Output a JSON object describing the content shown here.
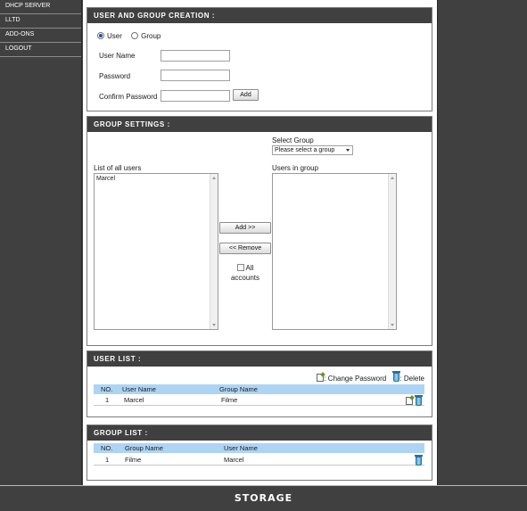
{
  "sidebar": {
    "items": [
      {
        "label": "DHCP SERVER"
      },
      {
        "label": "LLTD"
      },
      {
        "label": "ADD-ONS"
      },
      {
        "label": "LOGOUT"
      }
    ]
  },
  "creation": {
    "title": "USER AND GROUP CREATION :",
    "radio_user": "User",
    "radio_group": "Group",
    "selected": "User",
    "username_label": "User Name",
    "password_label": "Password",
    "confirm_label": "Confirm Password",
    "add_button": "Add"
  },
  "group_settings": {
    "title": "GROUP SETTINGS :",
    "select_group_label": "Select Group",
    "select_group_value": "Please select a group",
    "all_users_label": "List of all users",
    "all_users": [
      "Marcel"
    ],
    "users_in_group_label": "Users in group",
    "add_button": "Add >>",
    "remove_button": "<< Remove",
    "all_label": "All",
    "accounts_label": "accounts"
  },
  "user_list": {
    "title": "USER LIST :",
    "change_password_legend": ": Change Password",
    "delete_legend": ": Delete",
    "headers": {
      "no": "NO.",
      "user": "User Name",
      "group": "Group Name"
    },
    "rows": [
      {
        "no": "1",
        "user": "Marcel",
        "group": "Filme"
      }
    ]
  },
  "group_list": {
    "title": "GROUP LIST :",
    "headers": {
      "no": "NO.",
      "group": "Group Name",
      "user": "User Name"
    },
    "rows": [
      {
        "no": "1",
        "group": "Filme",
        "user": "Marcel"
      }
    ]
  },
  "footer": {
    "label": "STORAGE"
  },
  "colors": {
    "header_bg": "#404040",
    "table_header_bg": "#aed4f5",
    "page_bg": "#404040"
  }
}
